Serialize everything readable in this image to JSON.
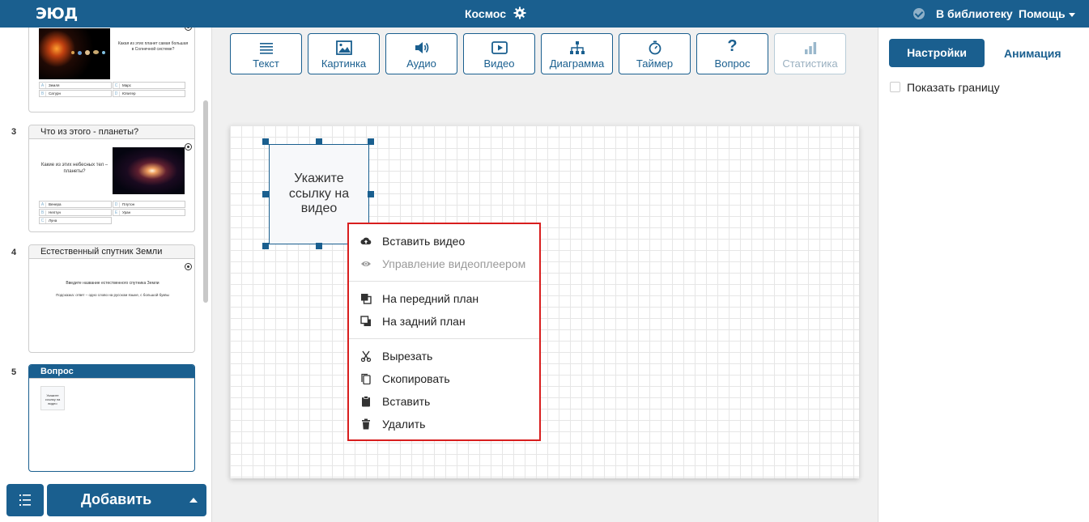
{
  "header": {
    "logo": "ЭЮД",
    "document_title": "Космос",
    "library_label": "В библиотеку",
    "help_label": "Помощь"
  },
  "sidebar": {
    "slides": [
      {
        "number": "",
        "title": "",
        "question": "Какая из этих планет самая большая в Солнечной системе?",
        "answers": [
          {
            "letter": "A",
            "text": "Земля"
          },
          {
            "letter": "C",
            "text": "Марс"
          },
          {
            "letter": "B",
            "text": "Сатурн"
          },
          {
            "letter": "D",
            "text": "Юпитер"
          }
        ]
      },
      {
        "number": "3",
        "title": "Что из этого - планеты?",
        "question": "Какие из этих небесных тел – планеты?",
        "answers": [
          {
            "letter": "A",
            "text": "Венера"
          },
          {
            "letter": "D",
            "text": "Плутон"
          },
          {
            "letter": "B",
            "text": "Нептун"
          },
          {
            "letter": "E",
            "text": "Уран"
          },
          {
            "letter": "C",
            "text": "Луна"
          }
        ]
      },
      {
        "number": "4",
        "title": "Естественный спутник Земли",
        "question": "Введите название естественного спутника Земли",
        "hint": "Подсказка: ответ – одно слово на русском языке, с большой буквы"
      },
      {
        "number": "5",
        "title": "Вопрос",
        "thumb_text": "Укажите ссылку на видео"
      }
    ],
    "add_button": "Добавить"
  },
  "toolbar": {
    "tools": [
      {
        "label": "Текст",
        "icon": "text-lines-icon"
      },
      {
        "label": "Картинка",
        "icon": "image-icon"
      },
      {
        "label": "Аудио",
        "icon": "speaker-icon"
      },
      {
        "label": "Видео",
        "icon": "video-play-icon"
      },
      {
        "label": "Диаграмма",
        "icon": "hierarchy-icon"
      },
      {
        "label": "Таймер",
        "icon": "stopwatch-icon"
      },
      {
        "label": "Вопрос",
        "icon": "question-icon"
      },
      {
        "label": "Статистика",
        "icon": "bar-stats-icon",
        "disabled": true
      }
    ]
  },
  "canvas": {
    "video_placeholder": "Укажите ссылку на видео"
  },
  "context_menu": {
    "items": [
      {
        "label": "Вставить видео",
        "icon": "cloud-upload-icon"
      },
      {
        "label": "Управление видеоплеером",
        "icon": "eye-icon",
        "disabled": true
      },
      {
        "label": "На передний план",
        "icon": "bring-front-icon"
      },
      {
        "label": "На задний план",
        "icon": "send-back-icon"
      },
      {
        "label": "Вырезать",
        "icon": "scissors-icon"
      },
      {
        "label": "Скопировать",
        "icon": "copy-icon"
      },
      {
        "label": "Вставить",
        "icon": "clipboard-icon"
      },
      {
        "label": "Удалить",
        "icon": "trash-icon"
      }
    ]
  },
  "right_panel": {
    "tab_settings": "Настройки",
    "tab_animation": "Анимация",
    "show_border_label": "Показать границу",
    "show_border_checked": false
  },
  "colors": {
    "primary": "#1a5f8f",
    "highlight": "#d81e1e"
  }
}
